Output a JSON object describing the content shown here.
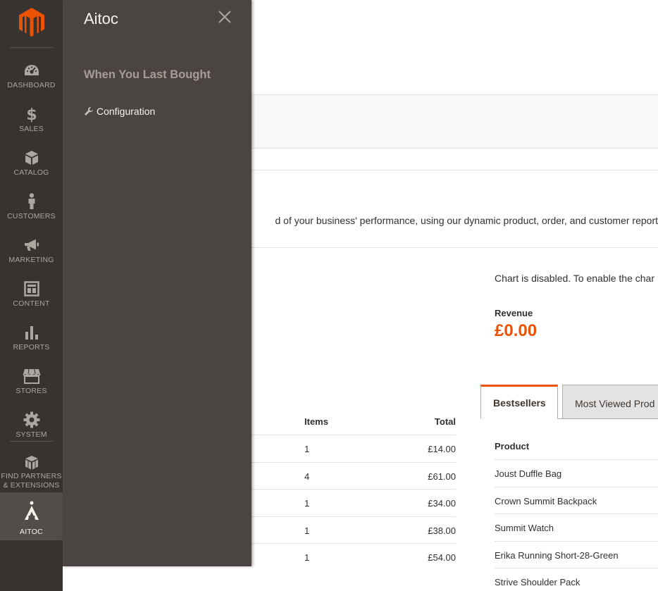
{
  "admin_menu": {
    "items": [
      {
        "label": "DASHBOARD",
        "icon": "dashboard-icon"
      },
      {
        "label": "SALES",
        "icon": "dollar-icon"
      },
      {
        "label": "CATALOG",
        "icon": "box-icon"
      },
      {
        "label": "CUSTOMERS",
        "icon": "person-icon"
      },
      {
        "label": "MARKETING",
        "icon": "megaphone-icon"
      },
      {
        "label": "CONTENT",
        "icon": "layout-icon"
      },
      {
        "label": "REPORTS",
        "icon": "bar-chart-icon"
      },
      {
        "label": "STORES",
        "icon": "storefront-icon"
      },
      {
        "label": "SYSTEM",
        "icon": "gear-icon"
      },
      {
        "label_line1": "FIND PARTNERS",
        "label_line2": "& EXTENSIONS",
        "icon": "boxes-icon"
      },
      {
        "label": "AITOC",
        "icon": "aitoc-icon",
        "active": true
      }
    ],
    "colors": {
      "background": "#373330",
      "active": "#524d49",
      "logo": "#eb5202"
    }
  },
  "submenu": {
    "title": "Aitoc",
    "group_title": "When You Last Bought",
    "link_label": "Configuration",
    "link_icon": "wrench-icon",
    "close_icon": "close-icon"
  },
  "dashboard": {
    "intro_text": "d of your business' performance, using our dynamic product, order, and customer report",
    "chart_disabled": "Chart is disabled. To enable the char",
    "revenue_label": "Revenue",
    "revenue_value": "£0.00",
    "accent_color": "#eb5202"
  },
  "last_orders": {
    "headers": {
      "items": "Items",
      "total": "Total"
    },
    "rows": [
      {
        "items": "1",
        "total": "£14.00"
      },
      {
        "items": "4",
        "total": "£61.00"
      },
      {
        "items": "1",
        "total": "£34.00"
      },
      {
        "items": "1",
        "total": "£38.00"
      },
      {
        "items": "1",
        "total": "£54.00"
      }
    ]
  },
  "tabs": {
    "active": "Bestsellers",
    "inactive": "Most Viewed Prod"
  },
  "bestsellers": {
    "header": "Product",
    "rows": [
      "Joust Duffle Bag",
      "Crown Summit Backpack",
      "Summit Watch",
      "Erika Running Short-28-Green",
      "Strive Shoulder Pack"
    ]
  }
}
